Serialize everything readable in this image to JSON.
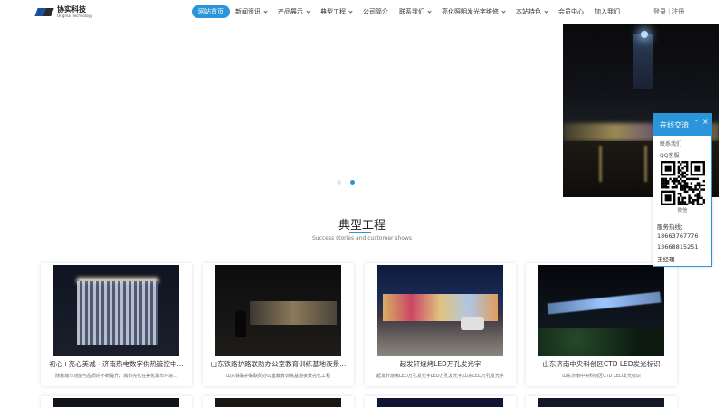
{
  "logo": {
    "name_cn": "协实科技",
    "name_en": "Original Technology"
  },
  "nav": {
    "items": [
      {
        "label": "网站首页",
        "active": true,
        "dropdown": false
      },
      {
        "label": "新闻资讯",
        "dropdown": true
      },
      {
        "label": "产品展示",
        "dropdown": true
      },
      {
        "label": "典型工程",
        "dropdown": true
      },
      {
        "label": "公司简介",
        "dropdown": false
      },
      {
        "label": "联系我们",
        "dropdown": true
      },
      {
        "label": "亮化照明发光字维修",
        "dropdown": true
      },
      {
        "label": "本站特色",
        "dropdown": true
      },
      {
        "label": "会员中心",
        "dropdown": false
      },
      {
        "label": "加入我们",
        "dropdown": false
      }
    ],
    "login": "登录",
    "separator": "|",
    "register": "注册"
  },
  "banner": {
    "slide_count": 2,
    "active_slide": 2
  },
  "section": {
    "title": "典型工程",
    "subtitle": "Success stories and customer shows"
  },
  "cards": [
    {
      "title": "初心+亮心美城 - 济南热电数字供热管控中...",
      "desc": "随着城市功能与品质的不断提升，城市亮化在美化城市环境..."
    },
    {
      "title": "山东铁路护路联防办公室教育训练基地夜景...",
      "desc": "山东铁路护路联防办公室教育训练基地夜景亮化工程"
    },
    {
      "title": "起发轩烧烤LED万孔发光字",
      "desc": "起发轩烧烤LED万孔发光字LED万孔发光字,山东LED万孔发光字"
    },
    {
      "title": "山东济南中央科创区CTD LED发光标识",
      "desc": "山东济南中央科创区CTD LED发光标识"
    }
  ],
  "service": {
    "title": "在线交流",
    "minimize": "-",
    "close": "×",
    "contact_link": "联系我们",
    "qq_link": "QQ客服",
    "wechat_label": "微信",
    "hotline_label": "服务热线：",
    "phones": [
      "18663767776",
      "13668815251"
    ],
    "manager": "王经理"
  },
  "colors": {
    "accent": "#2a95d8",
    "text": "#333333"
  }
}
